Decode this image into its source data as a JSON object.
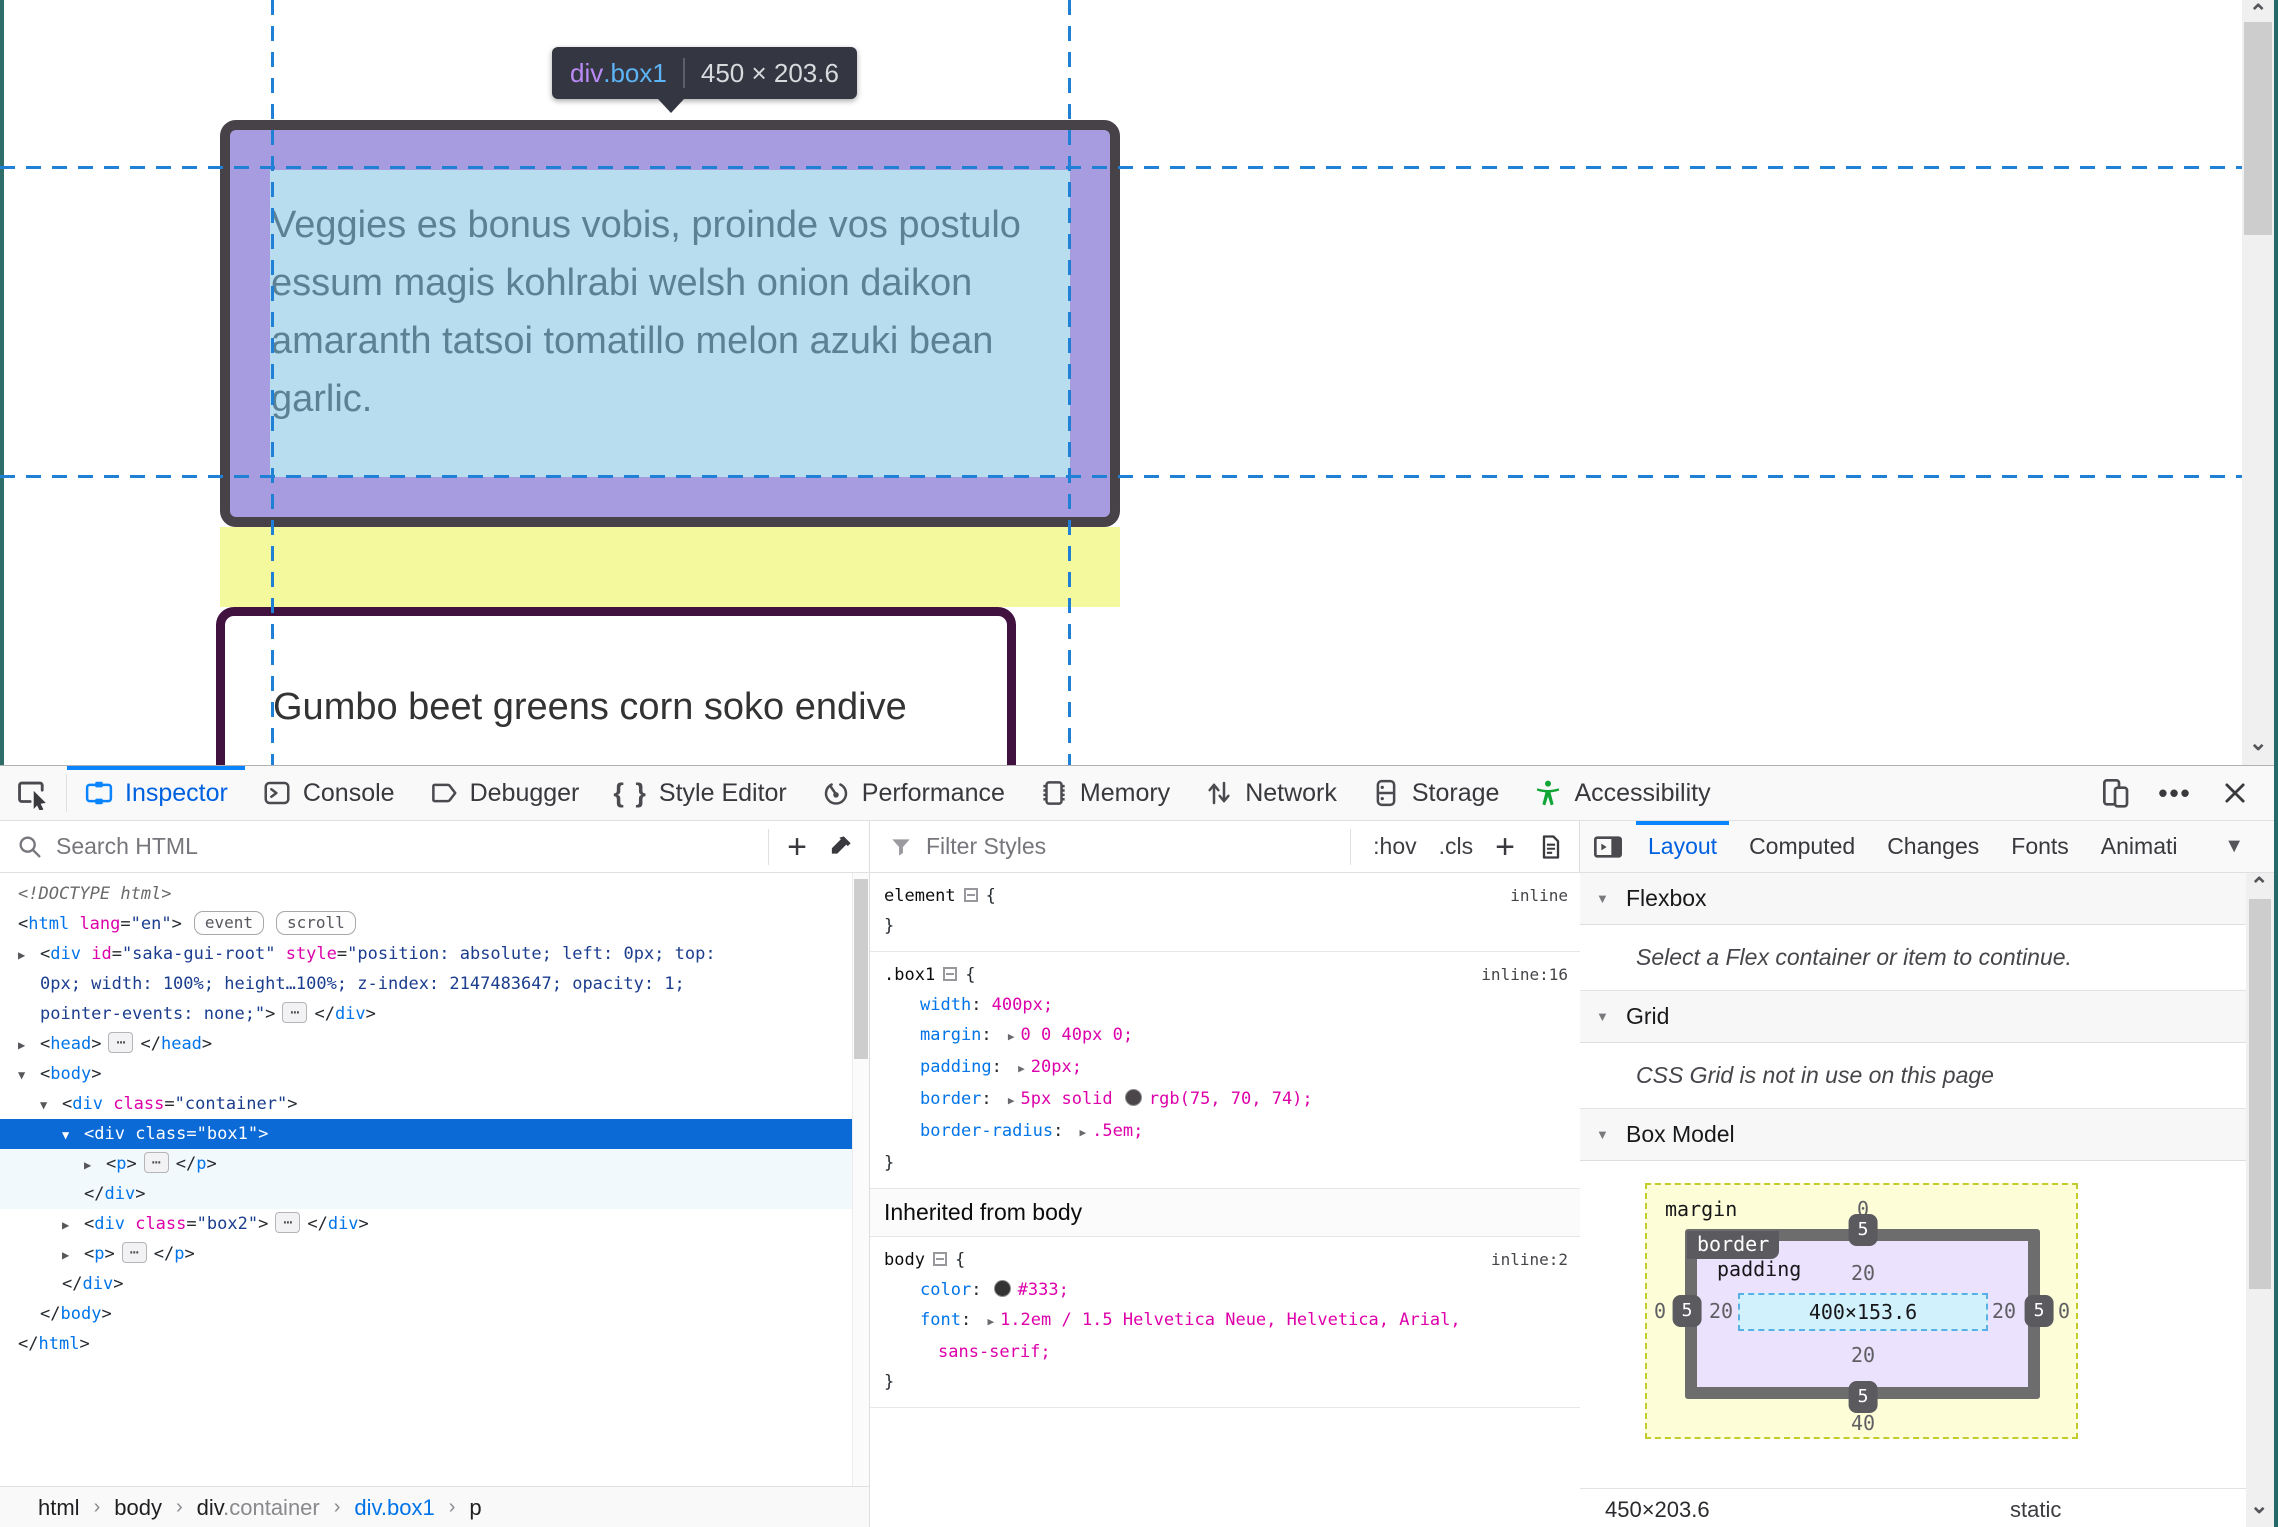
{
  "page": {
    "tooltip": {
      "tag": "div",
      "cls": ".box1",
      "dims": "450 × 203.6"
    },
    "box1_text": "Veggies es bonus vobis, proinde vos postulo essum magis kohlrabi welsh onion daikon amaranth tatsoi tomatillo melon azuki bean garlic.",
    "box2_text": "Gumbo beet greens corn soko endive"
  },
  "toolbar": {
    "tabs": [
      {
        "id": "inspector",
        "label": "Inspector",
        "active": true
      },
      {
        "id": "console",
        "label": "Console"
      },
      {
        "id": "debugger",
        "label": "Debugger"
      },
      {
        "id": "style-editor",
        "label": "Style Editor"
      },
      {
        "id": "performance",
        "label": "Performance"
      },
      {
        "id": "memory",
        "label": "Memory"
      },
      {
        "id": "network",
        "label": "Network"
      },
      {
        "id": "storage",
        "label": "Storage"
      },
      {
        "id": "accessibility",
        "label": "Accessibility"
      }
    ]
  },
  "markup": {
    "search_placeholder": "Search HTML",
    "rows": [
      {
        "level": 0,
        "segs": [
          [
            "d",
            "<!DOCTYPE html>"
          ]
        ]
      },
      {
        "level": 0,
        "segs": [
          [
            "p",
            "<"
          ],
          [
            "t",
            "html"
          ],
          [
            "a",
            " lang"
          ],
          [
            "p",
            "="
          ],
          [
            "v",
            "\"en\""
          ],
          [
            "p",
            ">"
          ]
        ],
        "badges": [
          "event",
          "scroll"
        ]
      },
      {
        "level": 1,
        "twisty": "r",
        "segs": [
          [
            "p",
            "<"
          ],
          [
            "t",
            "div"
          ],
          [
            "a",
            " id"
          ],
          [
            "p",
            "="
          ],
          [
            "v",
            "\"saka-gui-root\""
          ],
          [
            "a",
            " style"
          ],
          [
            "p",
            "="
          ],
          [
            "v",
            "\"position: absolute; left: 0px; top:"
          ]
        ]
      },
      {
        "level": 1,
        "cont": true,
        "segs": [
          [
            "v",
            "0px; width: 100%; height…100%; z-index: 2147483647; opacity: 1;"
          ]
        ]
      },
      {
        "level": 1,
        "cont": true,
        "segs": [
          [
            "v",
            "pointer-events: none;\""
          ],
          [
            "p",
            ">"
          ],
          [
            "dots",
            ""
          ],
          [
            "p",
            "</"
          ],
          [
            "t",
            "div"
          ],
          [
            "p",
            ">"
          ]
        ]
      },
      {
        "level": 1,
        "twisty": "r",
        "segs": [
          [
            "p",
            "<"
          ],
          [
            "t",
            "head"
          ],
          [
            "p",
            ">"
          ],
          [
            "dots",
            ""
          ],
          [
            "p",
            "</"
          ],
          [
            "t",
            "head"
          ],
          [
            "p",
            ">"
          ]
        ]
      },
      {
        "level": 1,
        "twisty": "d",
        "segs": [
          [
            "p",
            "<"
          ],
          [
            "t",
            "body"
          ],
          [
            "p",
            ">"
          ]
        ]
      },
      {
        "level": 2,
        "twisty": "d",
        "segs": [
          [
            "p",
            "<"
          ],
          [
            "t",
            "div"
          ],
          [
            "a",
            " class"
          ],
          [
            "p",
            "="
          ],
          [
            "v",
            "\"container\""
          ],
          [
            "p",
            ">"
          ]
        ]
      },
      {
        "level": 3,
        "twisty": "d",
        "selected": true,
        "segs": [
          [
            "p",
            "<"
          ],
          [
            "t",
            "div"
          ],
          [
            "a",
            " class"
          ],
          [
            "p",
            "="
          ],
          [
            "v",
            "\"box1\""
          ],
          [
            "p",
            ">"
          ]
        ]
      },
      {
        "level": 4,
        "twisty": "r",
        "childbg": true,
        "segs": [
          [
            "p",
            "<"
          ],
          [
            "t",
            "p"
          ],
          [
            "p",
            ">"
          ],
          [
            "dots",
            ""
          ],
          [
            "p",
            "</"
          ],
          [
            "t",
            "p"
          ],
          [
            "p",
            ">"
          ]
        ]
      },
      {
        "level": 3,
        "closing": true,
        "childbg": true,
        "segs": [
          [
            "p",
            "</"
          ],
          [
            "t",
            "div"
          ],
          [
            "p",
            ">"
          ]
        ]
      },
      {
        "level": 3,
        "twisty": "r",
        "segs": [
          [
            "p",
            "<"
          ],
          [
            "t",
            "div"
          ],
          [
            "a",
            " class"
          ],
          [
            "p",
            "="
          ],
          [
            "v",
            "\"box2\""
          ],
          [
            "p",
            ">"
          ],
          [
            "dots",
            ""
          ],
          [
            "p",
            "</"
          ],
          [
            "t",
            "div"
          ],
          [
            "p",
            ">"
          ]
        ]
      },
      {
        "level": 3,
        "twisty": "r",
        "segs": [
          [
            "p",
            "<"
          ],
          [
            "t",
            "p"
          ],
          [
            "p",
            ">"
          ],
          [
            "dots",
            ""
          ],
          [
            "p",
            "</"
          ],
          [
            "t",
            "p"
          ],
          [
            "p",
            ">"
          ]
        ]
      },
      {
        "level": 2,
        "closing": true,
        "segs": [
          [
            "p",
            "</"
          ],
          [
            "t",
            "div"
          ],
          [
            "p",
            ">"
          ]
        ]
      },
      {
        "level": 1,
        "closing": true,
        "segs": [
          [
            "p",
            "</"
          ],
          [
            "t",
            "body"
          ],
          [
            "p",
            ">"
          ]
        ]
      },
      {
        "level": 0,
        "closing": true,
        "segs": [
          [
            "p",
            "</"
          ],
          [
            "t",
            "html"
          ],
          [
            "p",
            ">"
          ]
        ]
      }
    ]
  },
  "rules": {
    "filter_placeholder": "Filter Styles",
    "pseudo_toggle": ":hov",
    "class_toggle": ".cls",
    "rules": [
      {
        "selector": "element",
        "link": "inline",
        "props": []
      },
      {
        "selector": ".box1",
        "link": "inline:16",
        "props": [
          {
            "name": "width",
            "value": "400px;"
          },
          {
            "name": "margin",
            "arrow": true,
            "value": "0 0 40px 0;"
          },
          {
            "name": "padding",
            "arrow": true,
            "value": "20px;"
          },
          {
            "name": "border",
            "arrow": true,
            "pre": "5px solid",
            "swatch": "#4b464a",
            "post": "rgb(75, 70, 74);"
          },
          {
            "name": "border-radius",
            "arrow": true,
            "value": ".5em;"
          }
        ]
      }
    ],
    "inherited_label": "Inherited from body",
    "body_rule": {
      "selector": "body",
      "link": "inline:2",
      "props": [
        {
          "name": "color",
          "swatch": "#333333",
          "value": "#333;"
        },
        {
          "name": "font",
          "arrow": true,
          "value": "1.2em / 1.5 Helvetica Neue, Helvetica, Arial,",
          "value2": "sans-serif;"
        }
      ]
    }
  },
  "sidebar": {
    "tabs": [
      {
        "label": "Layout",
        "active": true
      },
      {
        "label": "Computed"
      },
      {
        "label": "Changes"
      },
      {
        "label": "Fonts"
      },
      {
        "label": "Animati"
      }
    ],
    "flexbox": {
      "title": "Flexbox",
      "message": "Select a Flex container or item to continue."
    },
    "grid": {
      "title": "Grid",
      "message": "CSS Grid is not in use on this page"
    },
    "boxmodel": {
      "title": "Box Model",
      "margin_label": "margin",
      "border_label": "border",
      "padding_label": "padding",
      "margin": {
        "top": "0",
        "right": "0",
        "bottom": "40",
        "left": "0"
      },
      "border": {
        "top": "5",
        "right": "5",
        "bottom": "5",
        "left": "5"
      },
      "padding": {
        "top": "20",
        "right": "20",
        "bottom": "20",
        "left": "20"
      },
      "content": "400×153.6",
      "footer_dims": "450×203.6",
      "footer_position": "static"
    }
  },
  "breadcrumb": {
    "separator": "›",
    "items": [
      {
        "label": "html"
      },
      {
        "label": "body"
      },
      {
        "label": "div",
        "suffix": ".container"
      },
      {
        "label": "div.box1",
        "selected": true
      },
      {
        "label": "p"
      }
    ]
  }
}
